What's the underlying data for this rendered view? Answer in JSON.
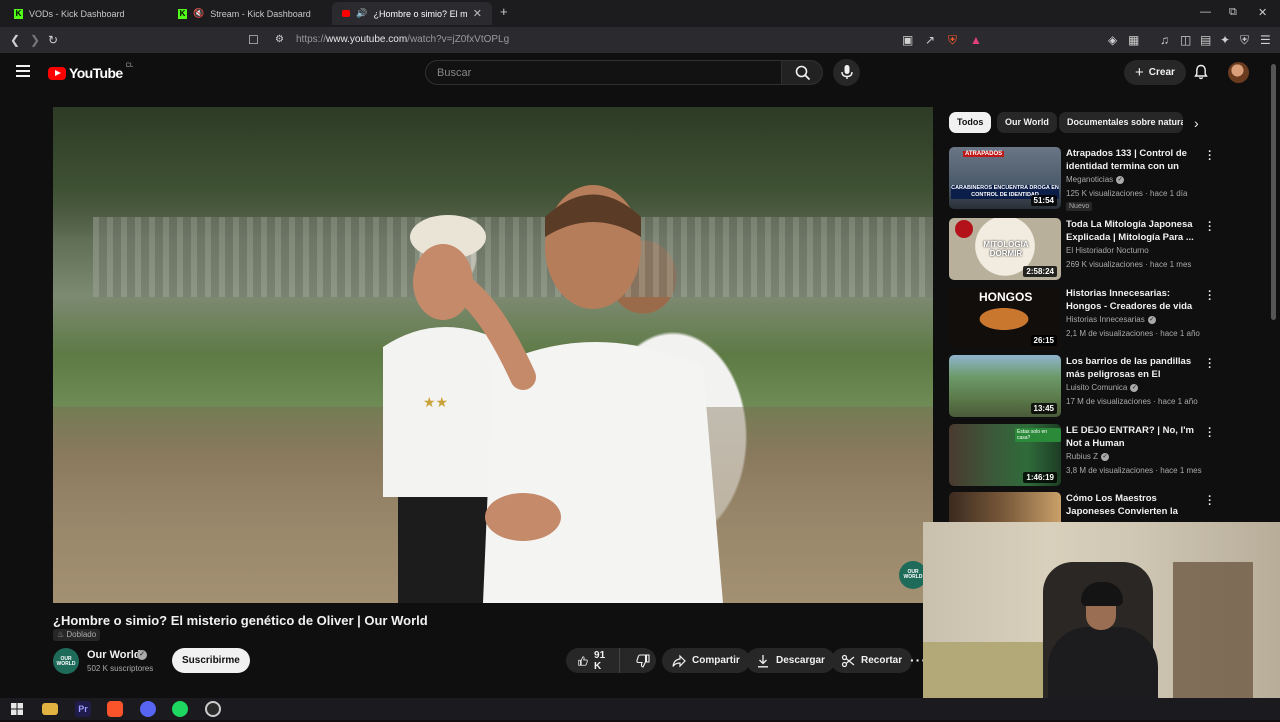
{
  "browser": {
    "tabs": [
      {
        "label": "VODs - Kick Dashboard",
        "active": false
      },
      {
        "label": "Stream - Kick Dashboard",
        "active": false
      },
      {
        "label": "¿Hombre o simio? El misterio",
        "active": true
      }
    ],
    "url_prefix": "https://",
    "url_domain": "www.youtube.com",
    "url_path": "/watch?v=jZ0fxVtOPLg"
  },
  "header": {
    "logo_text": "YouTube",
    "country_code": "CL",
    "search_placeholder": "Buscar",
    "create_label": "Crear"
  },
  "video": {
    "title": "¿Hombre o simio? El misterio genético de Oliver | Our World",
    "dub_badge": "Doblado",
    "watermark": "OUR WORLD",
    "channel": {
      "name": "Our World",
      "avatar_text": "OUR WORLD",
      "subscribers": "502 K suscriptores",
      "verified": true
    },
    "subscribe_label": "Suscribirme",
    "likes": "91 K",
    "share_label": "Compartir",
    "download_label": "Descargar",
    "clip_label": "Recortar"
  },
  "chips": [
    {
      "label": "Todos",
      "active": true
    },
    {
      "label": "Our World",
      "active": false
    },
    {
      "label": "Documentales sobre naturaleza",
      "active": false
    }
  ],
  "recommendations": [
    {
      "title": "Atrapados 133 | Control de identidad termina con un sujet...",
      "channel": "Meganoticias",
      "verified": true,
      "views": "125 K visualizaciones",
      "age": "hace 1 día",
      "badge": "Nuevo",
      "duration": "51:54",
      "thumb_text": "CARABINEROS ENCUENTRA DROGA EN CONTROL DE IDENTIDAD",
      "thumb_color": "#4b5a6a"
    },
    {
      "title": "Toda La Mitología Japonesa Explicada | Mitología Para ...",
      "channel": "El Historiador Nocturno",
      "verified": false,
      "views": "269 K visualizaciones",
      "age": "hace 1 mes",
      "badge": "",
      "duration": "2:58:24",
      "thumb_text": "MITOLOGIA DORMIR",
      "thumb_color": "#cfc6b3"
    },
    {
      "title": "Historias Innecesarias: Hongos - Creadores de vida",
      "channel": "Historias Innecesarias",
      "verified": true,
      "views": "2,1 M de visualizaciones",
      "age": "hace 1 año",
      "badge": "",
      "duration": "26:15",
      "thumb_text": "HONGOS",
      "thumb_color": "#1a1410"
    },
    {
      "title": "Los barrios de las pandillas más peligrosas en El Salvador | ...",
      "channel": "Luisito Comunica",
      "verified": true,
      "views": "17 M de visualizaciones",
      "age": "hace 1 año",
      "badge": "",
      "duration": "13:45",
      "thumb_text": "",
      "thumb_color": "#5b7a4a"
    },
    {
      "title": "LE DEJO ENTRAR? | No, I'm Not a Human",
      "channel": "Rubius Z",
      "verified": true,
      "views": "3,8 M de visualizaciones",
      "age": "hace 1 mes",
      "badge": "",
      "duration": "1:46:19",
      "thumb_text": "Estas solo en casa?",
      "thumb_color": "#2f6b3a"
    },
    {
      "title": "Cómo Los Maestros Japoneses Convierten la Arena en Espadas",
      "channel": "",
      "verified": false,
      "views": "",
      "age": "",
      "badge": "",
      "duration": "",
      "thumb_text": "",
      "thumb_color": "#7a5a3a"
    }
  ]
}
